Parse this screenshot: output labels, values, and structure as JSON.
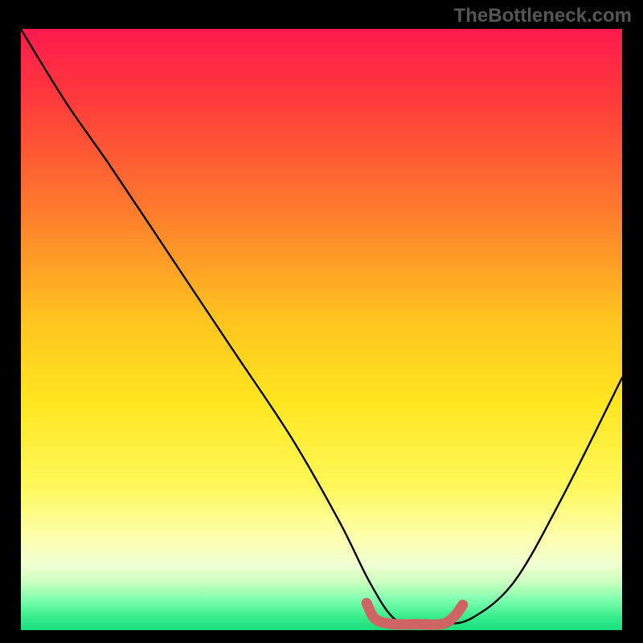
{
  "watermark": "TheBottleneck.com",
  "chart_data": {
    "type": "line",
    "title": "",
    "xlabel": "",
    "ylabel": "",
    "xlim": [
      0,
      100
    ],
    "ylim": [
      0,
      100
    ],
    "gradient_stops": [
      {
        "offset": 0,
        "color": "#ff1a4d"
      },
      {
        "offset": 12,
        "color": "#ff3b3b"
      },
      {
        "offset": 30,
        "color": "#ff7a2d"
      },
      {
        "offset": 48,
        "color": "#ffc31f"
      },
      {
        "offset": 62,
        "color": "#ffe61f"
      },
      {
        "offset": 76,
        "color": "#fff85a"
      },
      {
        "offset": 84,
        "color": "#fdffa8"
      },
      {
        "offset": 89,
        "color": "#f2ffd2"
      },
      {
        "offset": 92,
        "color": "#ccffbf"
      },
      {
        "offset": 95,
        "color": "#7dffb0"
      },
      {
        "offset": 98,
        "color": "#34ec8a"
      },
      {
        "offset": 100,
        "color": "#1adf7d"
      }
    ],
    "series": [
      {
        "name": "bottleneck-curve",
        "x": [
          0,
          3,
          8,
          15,
          25,
          35,
          45,
          53,
          58,
          62,
          66,
          70,
          75,
          82,
          90,
          100
        ],
        "y": [
          100,
          95,
          87,
          77,
          62,
          47,
          32,
          18,
          8,
          2,
          1,
          1,
          2,
          8,
          22,
          42
        ]
      },
      {
        "name": "highlight-sweet-spot",
        "x": [
          57.5,
          59,
          62,
          66,
          70,
          72,
          73.5
        ],
        "y": [
          4.5,
          1.8,
          1,
          1,
          1,
          2.2,
          4.2
        ]
      }
    ],
    "highlight_color": "#cf6464",
    "curve_color": "#000000"
  }
}
